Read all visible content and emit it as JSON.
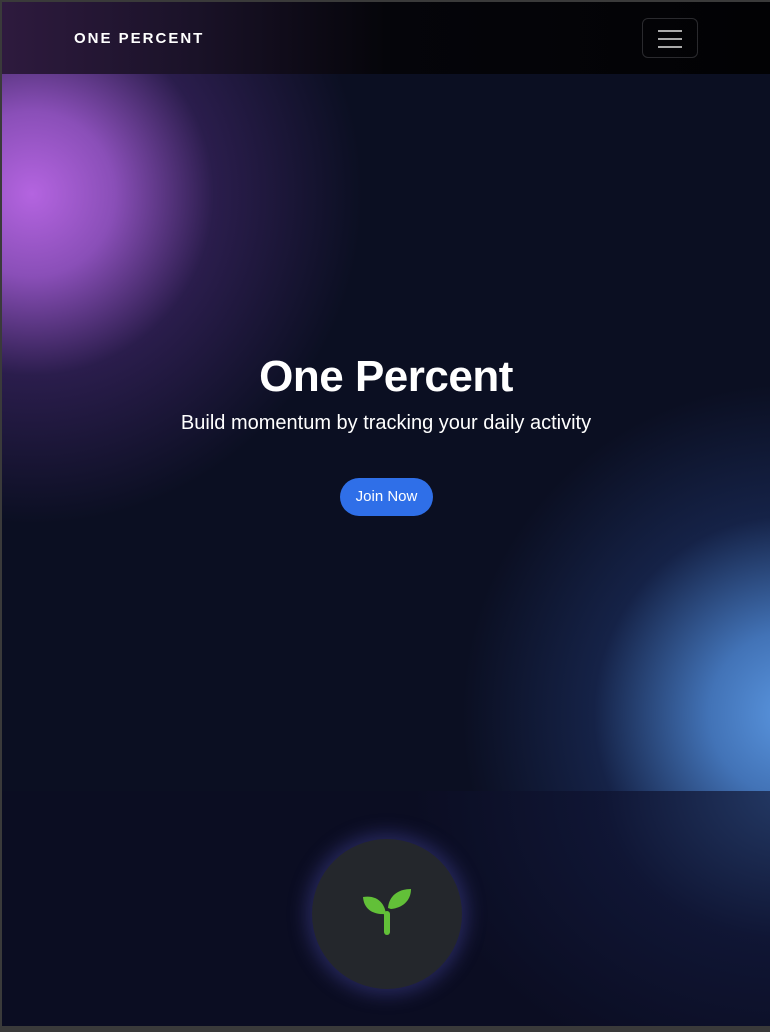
{
  "navbar": {
    "brand": "ONE PERCENT",
    "menu_icon": "hamburger-icon"
  },
  "hero": {
    "title": "One Percent",
    "subtitle": "Build momentum by tracking your daily activity",
    "cta_label": "Join Now",
    "cta_color": "#2f6fe8"
  },
  "feature": {
    "icon": "sprout-icon",
    "icon_color": "#62c038"
  }
}
